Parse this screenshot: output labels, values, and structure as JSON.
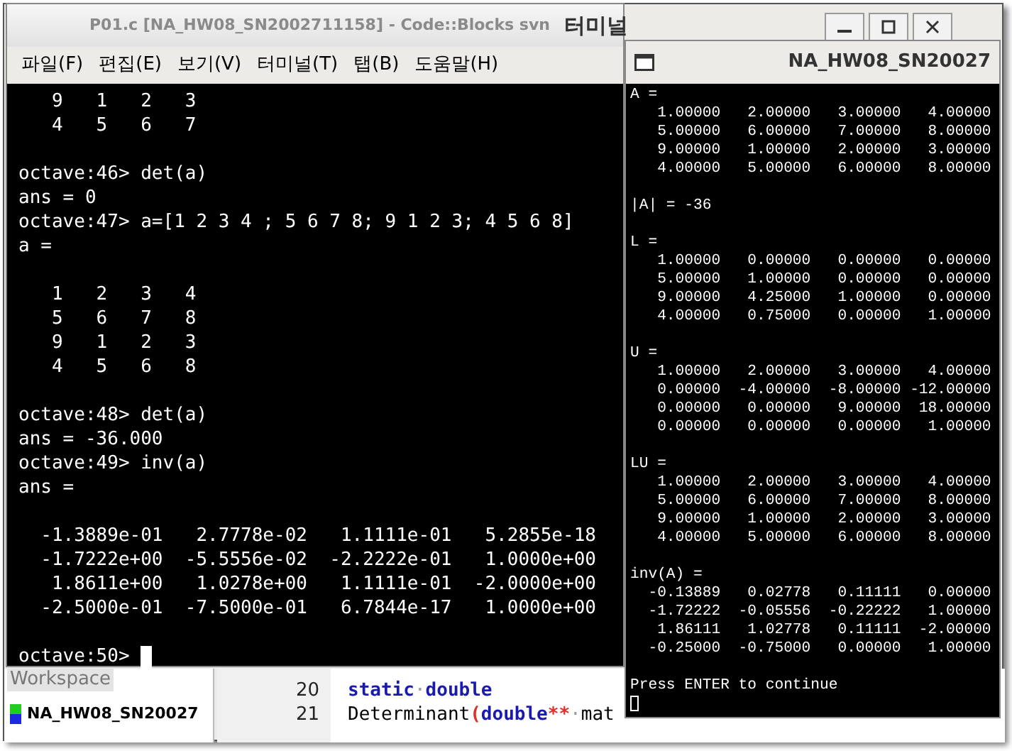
{
  "background_window": {
    "title": "P01.c [NA_HW08_SN2002711158] - Code::Blocks svn",
    "workspace_tab": "Workspace",
    "project": "NA_HW08_SN20027",
    "code_lines": [
      {
        "number": "20",
        "tokens": [
          {
            "text": "static",
            "kind": "keyword"
          },
          {
            "text": "·",
            "kind": "space"
          },
          {
            "text": "double",
            "kind": "keyword"
          }
        ]
      },
      {
        "number": "21",
        "tokens": [
          {
            "text": "Determinant",
            "kind": "plain"
          },
          {
            "text": "(",
            "kind": "operator"
          },
          {
            "text": "double",
            "kind": "keyword"
          },
          {
            "text": "**",
            "kind": "operator"
          },
          {
            "text": "·",
            "kind": "space"
          },
          {
            "text": "mat",
            "kind": "plain"
          }
        ]
      }
    ]
  },
  "terminal": {
    "title": "터미널",
    "menu": [
      "파일(F)",
      "편집(E)",
      "보기(V)",
      "터미널(T)",
      "탭(B)",
      "도움말(H)"
    ],
    "blocks": [
      [
        "   9   1   2   3",
        "   4   5   6   7"
      ],
      [
        "octave:46> det(a)",
        "ans = 0",
        "octave:47> a=[1 2 3 4 ; 5 6 7 8; 9 1 2 3; 4 5 6 8]",
        "a ="
      ],
      [
        "   1   2   3   4",
        "   5   6   7   8",
        "   9   1   2   3",
        "   4   5   6   8"
      ],
      [
        "octave:48> det(a)",
        "ans = -36.000",
        "octave:49> inv(a)",
        "ans ="
      ],
      [
        "  -1.3889e-01   2.7778e-02   1.1111e-01   5.2855e-18",
        "  -1.7222e+00  -5.5556e-02  -2.2222e-01   1.0000e+00",
        "   1.8611e+00   1.0278e+00   1.1111e-01  -2.0000e+00",
        "  -2.5000e-01  -7.5000e-01   6.7844e-17   1.0000e+00"
      ]
    ],
    "prompt": "octave:50>"
  },
  "console": {
    "title": "NA_HW08_SN20027",
    "sections": [
      {
        "label": "A =",
        "rows": [
          "   1.00000   2.00000   3.00000   4.00000",
          "   5.00000   6.00000   7.00000   8.00000",
          "   9.00000   1.00000   2.00000   3.00000",
          "   4.00000   5.00000   6.00000   8.00000"
        ]
      },
      {
        "label": "|A| = -36"
      },
      {
        "label": "L =",
        "rows": [
          "   1.00000   0.00000   0.00000   0.00000",
          "   5.00000   1.00000   0.00000   0.00000",
          "   9.00000   4.25000   1.00000   0.00000",
          "   4.00000   0.75000   0.00000   1.00000"
        ]
      },
      {
        "label": "U =",
        "rows": [
          "   1.00000   2.00000   3.00000   4.00000",
          "   0.00000  -4.00000  -8.00000 -12.00000",
          "   0.00000   0.00000   9.00000  18.00000",
          "   0.00000   0.00000   0.00000   1.00000"
        ]
      },
      {
        "label": "LU =",
        "rows": [
          "   1.00000   2.00000   3.00000   4.00000",
          "   5.00000   6.00000   7.00000   8.00000",
          "   9.00000   1.00000   2.00000   3.00000",
          "   4.00000   5.00000   6.00000   8.00000"
        ]
      },
      {
        "label": "inv(A) =",
        "rows": [
          "  -0.13889   0.02778   0.11111   0.00000",
          "  -1.72222  -0.05556  -0.22222   1.00000",
          "   1.86111   1.02778   0.11111  -2.00000",
          "  -0.25000  -0.75000   0.00000   1.00000"
        ]
      }
    ],
    "prompt": "Press ENTER to continue"
  }
}
